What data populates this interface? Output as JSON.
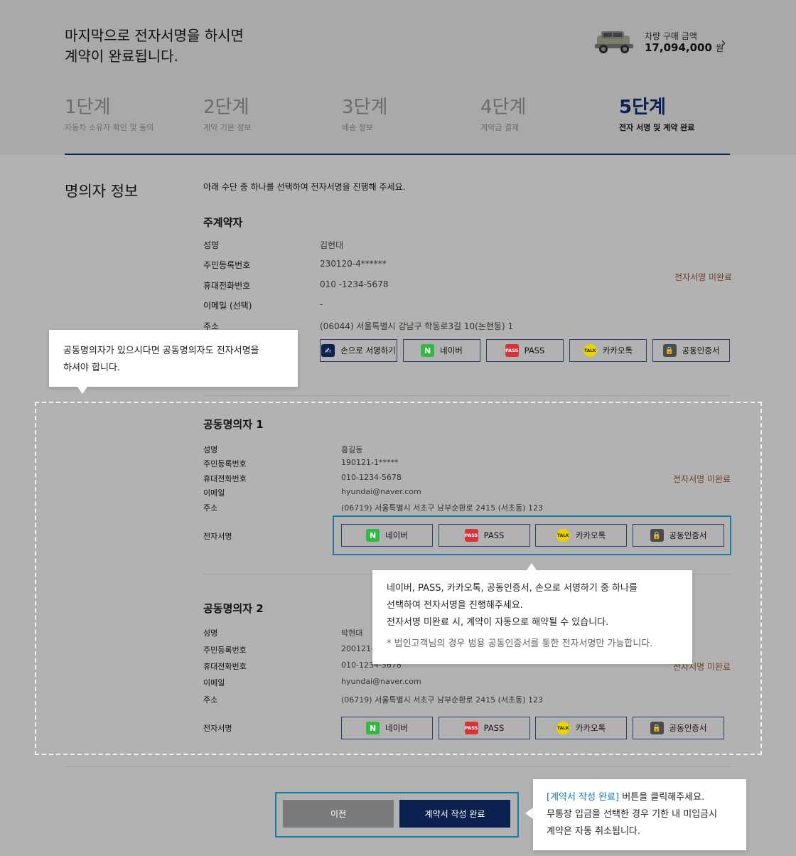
{
  "header": {
    "headline_line1": "마지막으로 전자서명을 하시면",
    "headline_line2": "계약이 완료됩니다.",
    "price_label": "차량 구매 금액",
    "price_value": "17,094,000",
    "price_unit": "원"
  },
  "steps": [
    {
      "num": "1단계",
      "sub": "자동차 소유자 확인 및 동의"
    },
    {
      "num": "2단계",
      "sub": "계약 기본 정보"
    },
    {
      "num": "3단계",
      "sub": "배송 정보"
    },
    {
      "num": "4단계",
      "sub": "계약금 결제"
    },
    {
      "num": "5단계",
      "sub": "전자 서명 및 계약 완료"
    }
  ],
  "section_title": "명의자 정보",
  "intro": "아래 수단 중 하나를 선택하여 전자서명을 진행해 주세요.",
  "main_signer": {
    "title": "주계약자",
    "name_label": "성명",
    "name": "김현대",
    "rrn_label": "주민등록번호",
    "rrn": "230120-4******",
    "phone_label": "휴대전화번호",
    "phone": "010 -1234-5678",
    "email_label": "이메일",
    "email_opt": "(선택)",
    "email": "-",
    "addr_label": "주소",
    "addr": "(06044) 서울특별시 강남구 학동로3길 10(논현동) 1",
    "status": "전자서명 미완료",
    "buttons": {
      "hand": "손으로 서명하기",
      "naver": "네이버",
      "pass": "PASS",
      "kakao": "카카오톡",
      "cert": "공동인증서"
    }
  },
  "co_signer1": {
    "title": "공동명의자 1",
    "name_label": "성명",
    "name": "홍길동",
    "rrn_label": "주민등록번호",
    "rrn": "190121-1*****",
    "phone_label": "휴대전화번호",
    "phone": "010-1234-5678",
    "email_label": "이메일",
    "email": "hyundai@naver.com",
    "addr_label": "주소",
    "addr": "(06719) 서울특별시 서초구 남부순환로 2415 (서초동) 123",
    "sign_label": "전자서명",
    "status": "전자서명 미완료",
    "buttons": {
      "naver": "네이버",
      "pass": "PASS",
      "kakao": "카카오톡",
      "cert": "공동인증서"
    }
  },
  "co_signer2": {
    "title": "공동명의자 2",
    "name_label": "성명",
    "name": "박현대",
    "rrn_label": "주민등록번호",
    "rrn": "200121-",
    "phone_label": "휴대전화번호",
    "phone": "010-1234-5678",
    "email_label": "이메일",
    "email": "hyundai@naver.com",
    "addr_label": "주소",
    "addr": "(06719) 서울특별시 서초구 남부순환로 2415 (서초동) 123",
    "sign_label": "전자서명",
    "status": "전자서명 미완료",
    "buttons": {
      "naver": "네이버",
      "pass": "PASS",
      "kakao": "카카오톡",
      "cert": "공동인증서"
    }
  },
  "icons": {
    "naver": "N",
    "pass": "PASS",
    "kakao": "TALK",
    "cert": "🔒",
    "hand": "✍"
  },
  "tooltips": {
    "co_signer_line1": "공동명의자가 있으시다면 공동명의자도 전자서명을",
    "co_signer_line2": "하셔야 합니다.",
    "methods_line1": "네이버, PASS, 카카오톡, 공동인증서, 손으로 서명하기 중 하나를",
    "methods_line2": "선택하여 전자서명을 진행해주세요.",
    "methods_line3": "전자서명 미완료 시, 계약이 자동으로 해약될 수 있습니다.",
    "methods_note": "* 법인고객님의 경우 범용 공동인증서를 통한 전자서명만 가능합니다.",
    "done_link": "[계약서 작성 완료]",
    "done_line1_rest": " 버튼을 클릭해주세요.",
    "done_line2": "무통장 입금을 선택한 경우 기한 내 미입금시",
    "done_line3": "계약은 자동 취소됩니다."
  },
  "actions": {
    "prev": "이전",
    "complete": "계약서 작성 완료"
  },
  "colors": {
    "navy": "#0b2150",
    "highlight": "#1b7aa6",
    "status": "#6e3e2d"
  }
}
